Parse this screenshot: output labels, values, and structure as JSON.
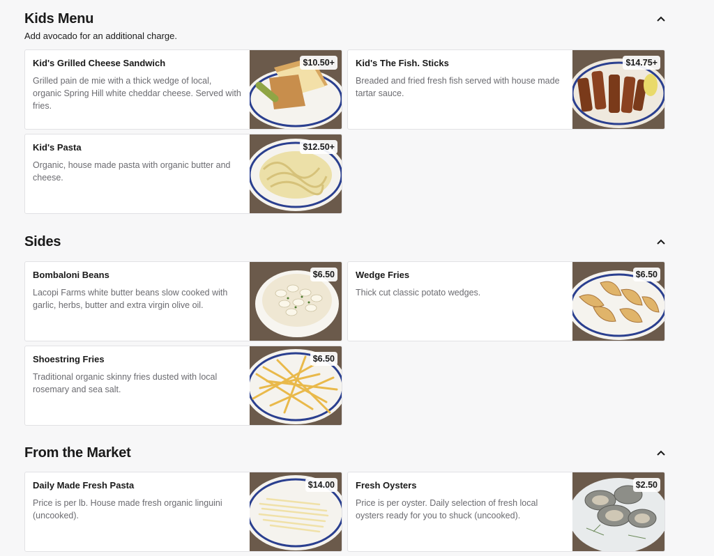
{
  "kids": {
    "title": "Kids Menu",
    "subtitle": "Add avocado for an additional charge.",
    "items": [
      {
        "name": "Kid's Grilled Cheese Sandwich",
        "desc": "Grilled pain de mie with a thick wedge of local, organic Spring Hill white cheddar cheese. Served with fries.",
        "price": "$10.50+",
        "image": "grilled-cheese-photo"
      },
      {
        "name": "Kid's The Fish. Sticks",
        "desc": "Breaded and fried fresh fish served with house made tartar sauce.",
        "price": "$14.75+",
        "image": "fish-sticks-photo"
      },
      {
        "name": "Kid's Pasta",
        "desc": "Organic, house made pasta with organic butter and cheese.",
        "price": "$12.50+",
        "image": "pasta-photo"
      }
    ]
  },
  "sides": {
    "title": "Sides",
    "items": [
      {
        "name": "Bombaloni Beans",
        "desc": "Lacopi Farms white butter beans slow cooked with garlic, herbs, butter and extra virgin olive oil.",
        "price": "$6.50",
        "image": "beans-photo"
      },
      {
        "name": "Wedge Fries",
        "desc": "Thick cut classic potato wedges.",
        "price": "$6.50",
        "image": "wedge-fries-photo"
      },
      {
        "name": "Shoestring Fries",
        "desc": "Traditional organic skinny fries dusted with local rosemary and sea salt.",
        "price": "$6.50",
        "image": "shoestring-fries-photo"
      }
    ]
  },
  "market": {
    "title": "From the Market",
    "items": [
      {
        "name": "Daily Made Fresh Pasta",
        "desc": "Price is per lb. House made fresh organic linguini (uncooked).",
        "price": "$14.00",
        "image": "fresh-pasta-photo"
      },
      {
        "name": "Fresh Oysters",
        "desc": "Price is per oyster. Daily selection of fresh local oysters ready for you to shuck (uncooked).",
        "price": "$2.50",
        "image": "oysters-photo"
      }
    ]
  },
  "icons": {
    "collapse": "chevron-up-icon"
  },
  "colors": {
    "background": "#f7f7f8",
    "card": "#ffffff",
    "border": "#e1e1e4",
    "desc_text": "#6b6b70",
    "plate_rim": "#2a3f8f"
  }
}
